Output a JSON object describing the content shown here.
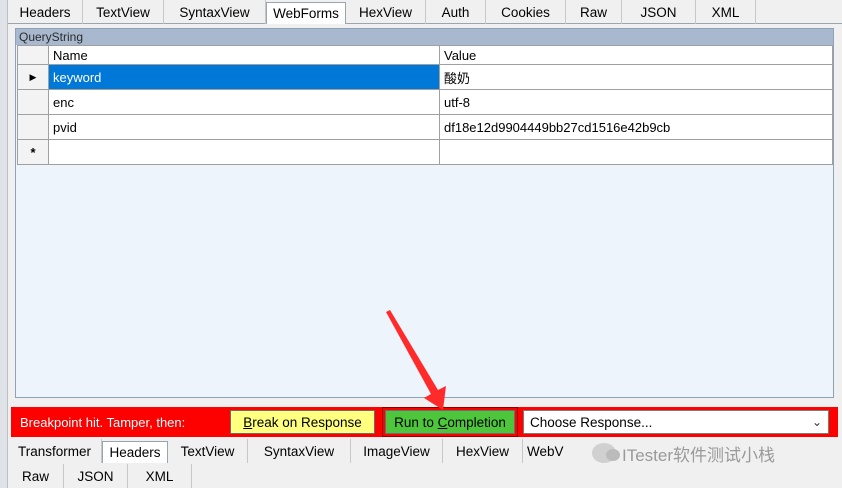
{
  "top_tabs": [
    "Headers",
    "TextView",
    "SyntaxView",
    "WebForms",
    "HexView",
    "Auth",
    "Cookies",
    "Raw",
    "JSON",
    "XML"
  ],
  "active_top_tab": "WebForms",
  "querystring": {
    "title": "QueryString",
    "columns": [
      "Name",
      "Value"
    ],
    "rows": [
      {
        "name": "keyword",
        "value": "酸奶",
        "selected": true
      },
      {
        "name": "enc",
        "value": "utf-8"
      },
      {
        "name": "pvid",
        "value": "df18e12d9904449bb27cd1516e42b9cb"
      }
    ],
    "new_row_marker": "*",
    "current_row_marker": "▶"
  },
  "tamper_bar": {
    "label": "Breakpoint hit. Tamper, then:",
    "break_button": {
      "prefix": "",
      "accel": "B",
      "rest": "reak on Response"
    },
    "run_button": {
      "prefix": "Run to ",
      "accel": "C",
      "rest": "ompletion"
    },
    "choose_response": "Choose Response...",
    "colors": {
      "bar": "#fd0000",
      "break_button": "#ffff80",
      "run_button": "#4ec63c"
    }
  },
  "bottom_tabs_row1": [
    "Transformer",
    "Headers",
    "TextView",
    "SyntaxView",
    "ImageView",
    "HexView",
    "WebV"
  ],
  "active_bottom_tab": "Headers",
  "bottom_tabs_row2": [
    "Raw",
    "JSON",
    "XML"
  ],
  "watermark": "ITester软件测试小栈",
  "annotation_arrow_color": "#ff2b2b"
}
